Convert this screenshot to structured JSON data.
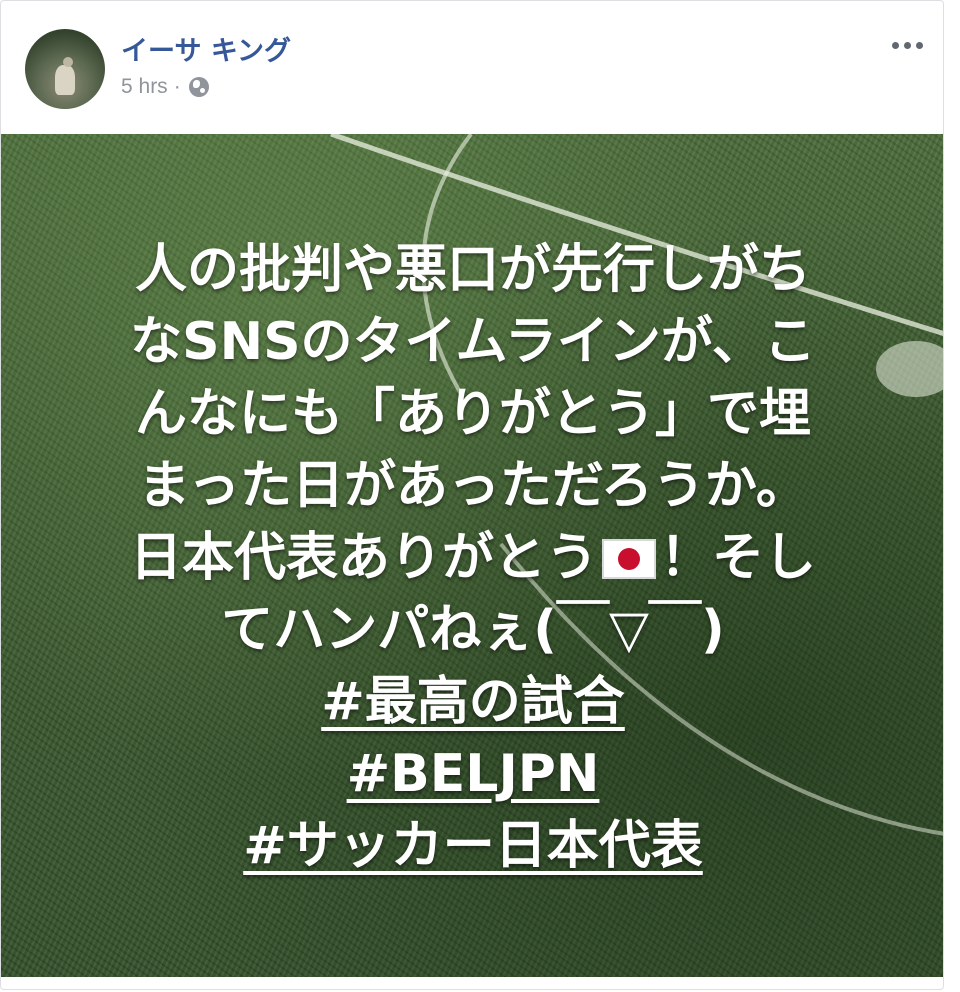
{
  "post": {
    "author": "イーサ キング",
    "timestamp": "5 hrs",
    "separator": "·",
    "privacy_icon": "globe-icon",
    "more_icon": "more-options-icon"
  },
  "image_text": {
    "line1": "人の批判や悪口が先行しがち",
    "line2": "なSNSのタイムラインが、こ",
    "line3": "んなにも「ありがとう」で埋",
    "line4": "まった日があっただろうか。",
    "line5_before_flag": "日本代表ありがとう",
    "flag_icon": "japan-flag-icon",
    "line5_after_flag": "！そし",
    "line6": "てハンパねぇ(￣▽￣)",
    "hashtags": [
      "#最高の試合",
      "#BELJPN",
      "#サッカー日本代表"
    ]
  },
  "colors": {
    "author": "#365899",
    "meta": "#90949c",
    "grass": "#3d5c30",
    "flag_red": "#c8102e"
  }
}
